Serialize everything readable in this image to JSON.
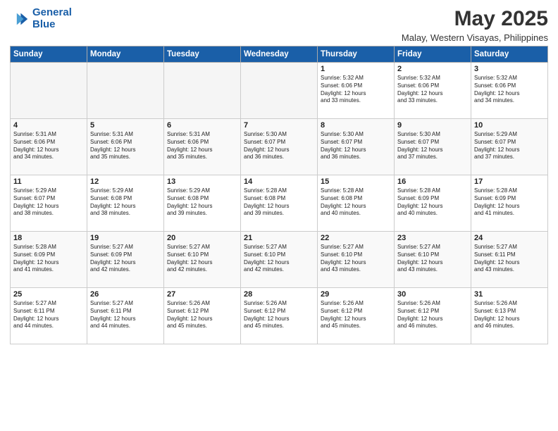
{
  "logo": {
    "line1": "General",
    "line2": "Blue"
  },
  "title": "May 2025",
  "subtitle": "Malay, Western Visayas, Philippines",
  "days_header": [
    "Sunday",
    "Monday",
    "Tuesday",
    "Wednesday",
    "Thursday",
    "Friday",
    "Saturday"
  ],
  "weeks": [
    [
      {
        "day": "",
        "info": ""
      },
      {
        "day": "",
        "info": ""
      },
      {
        "day": "",
        "info": ""
      },
      {
        "day": "",
        "info": ""
      },
      {
        "day": "1",
        "info": "Sunrise: 5:32 AM\nSunset: 6:06 PM\nDaylight: 12 hours\nand 33 minutes."
      },
      {
        "day": "2",
        "info": "Sunrise: 5:32 AM\nSunset: 6:06 PM\nDaylight: 12 hours\nand 33 minutes."
      },
      {
        "day": "3",
        "info": "Sunrise: 5:32 AM\nSunset: 6:06 PM\nDaylight: 12 hours\nand 34 minutes."
      }
    ],
    [
      {
        "day": "4",
        "info": "Sunrise: 5:31 AM\nSunset: 6:06 PM\nDaylight: 12 hours\nand 34 minutes."
      },
      {
        "day": "5",
        "info": "Sunrise: 5:31 AM\nSunset: 6:06 PM\nDaylight: 12 hours\nand 35 minutes."
      },
      {
        "day": "6",
        "info": "Sunrise: 5:31 AM\nSunset: 6:06 PM\nDaylight: 12 hours\nand 35 minutes."
      },
      {
        "day": "7",
        "info": "Sunrise: 5:30 AM\nSunset: 6:07 PM\nDaylight: 12 hours\nand 36 minutes."
      },
      {
        "day": "8",
        "info": "Sunrise: 5:30 AM\nSunset: 6:07 PM\nDaylight: 12 hours\nand 36 minutes."
      },
      {
        "day": "9",
        "info": "Sunrise: 5:30 AM\nSunset: 6:07 PM\nDaylight: 12 hours\nand 37 minutes."
      },
      {
        "day": "10",
        "info": "Sunrise: 5:29 AM\nSunset: 6:07 PM\nDaylight: 12 hours\nand 37 minutes."
      }
    ],
    [
      {
        "day": "11",
        "info": "Sunrise: 5:29 AM\nSunset: 6:07 PM\nDaylight: 12 hours\nand 38 minutes."
      },
      {
        "day": "12",
        "info": "Sunrise: 5:29 AM\nSunset: 6:08 PM\nDaylight: 12 hours\nand 38 minutes."
      },
      {
        "day": "13",
        "info": "Sunrise: 5:29 AM\nSunset: 6:08 PM\nDaylight: 12 hours\nand 39 minutes."
      },
      {
        "day": "14",
        "info": "Sunrise: 5:28 AM\nSunset: 6:08 PM\nDaylight: 12 hours\nand 39 minutes."
      },
      {
        "day": "15",
        "info": "Sunrise: 5:28 AM\nSunset: 6:08 PM\nDaylight: 12 hours\nand 40 minutes."
      },
      {
        "day": "16",
        "info": "Sunrise: 5:28 AM\nSunset: 6:09 PM\nDaylight: 12 hours\nand 40 minutes."
      },
      {
        "day": "17",
        "info": "Sunrise: 5:28 AM\nSunset: 6:09 PM\nDaylight: 12 hours\nand 41 minutes."
      }
    ],
    [
      {
        "day": "18",
        "info": "Sunrise: 5:28 AM\nSunset: 6:09 PM\nDaylight: 12 hours\nand 41 minutes."
      },
      {
        "day": "19",
        "info": "Sunrise: 5:27 AM\nSunset: 6:09 PM\nDaylight: 12 hours\nand 42 minutes."
      },
      {
        "day": "20",
        "info": "Sunrise: 5:27 AM\nSunset: 6:10 PM\nDaylight: 12 hours\nand 42 minutes."
      },
      {
        "day": "21",
        "info": "Sunrise: 5:27 AM\nSunset: 6:10 PM\nDaylight: 12 hours\nand 42 minutes."
      },
      {
        "day": "22",
        "info": "Sunrise: 5:27 AM\nSunset: 6:10 PM\nDaylight: 12 hours\nand 43 minutes."
      },
      {
        "day": "23",
        "info": "Sunrise: 5:27 AM\nSunset: 6:10 PM\nDaylight: 12 hours\nand 43 minutes."
      },
      {
        "day": "24",
        "info": "Sunrise: 5:27 AM\nSunset: 6:11 PM\nDaylight: 12 hours\nand 43 minutes."
      }
    ],
    [
      {
        "day": "25",
        "info": "Sunrise: 5:27 AM\nSunset: 6:11 PM\nDaylight: 12 hours\nand 44 minutes."
      },
      {
        "day": "26",
        "info": "Sunrise: 5:27 AM\nSunset: 6:11 PM\nDaylight: 12 hours\nand 44 minutes."
      },
      {
        "day": "27",
        "info": "Sunrise: 5:26 AM\nSunset: 6:12 PM\nDaylight: 12 hours\nand 45 minutes."
      },
      {
        "day": "28",
        "info": "Sunrise: 5:26 AM\nSunset: 6:12 PM\nDaylight: 12 hours\nand 45 minutes."
      },
      {
        "day": "29",
        "info": "Sunrise: 5:26 AM\nSunset: 6:12 PM\nDaylight: 12 hours\nand 45 minutes."
      },
      {
        "day": "30",
        "info": "Sunrise: 5:26 AM\nSunset: 6:12 PM\nDaylight: 12 hours\nand 46 minutes."
      },
      {
        "day": "31",
        "info": "Sunrise: 5:26 AM\nSunset: 6:13 PM\nDaylight: 12 hours\nand 46 minutes."
      }
    ]
  ]
}
